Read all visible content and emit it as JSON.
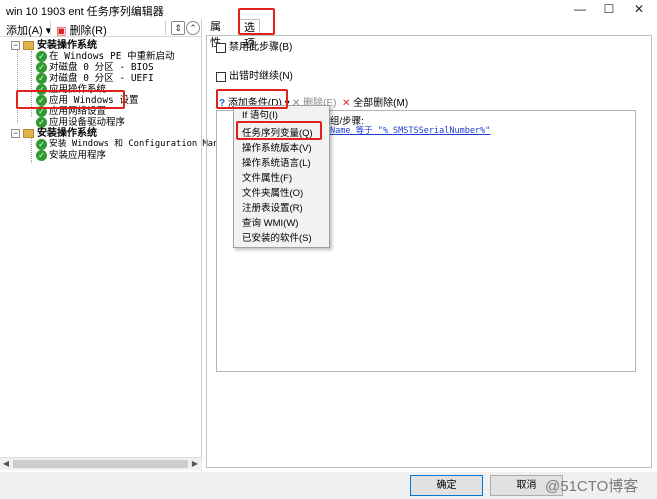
{
  "window": {
    "title": "win 10 1903 ent 任务序列编辑器",
    "minimize": "—",
    "maximize": "☐",
    "close": "✕"
  },
  "left_toolbar": {
    "add_label": "添加(A)",
    "add_caret": "▾",
    "delete_label": "删除(R)",
    "icons": [
      "move-icon",
      "up-arrow-icon",
      "down-arrow-icon"
    ]
  },
  "tree": {
    "group1": "安装操作系统",
    "items1": [
      "在 Windows PE 中重新启动",
      "对磁盘 0 分区 - BIOS",
      "对磁盘 0 分区 - UEFI",
      "应用操作系统",
      "应用 Windows 设置",
      "应用网络设置",
      "应用设备驱动程序"
    ],
    "group2": "安装操作系统",
    "items2": [
      "安装 Windows 和 Configuration Manager",
      "安装应用程序"
    ]
  },
  "tabs": {
    "properties": "属性",
    "options": "选项"
  },
  "options": {
    "disable_step": "禁用此步骤(B)",
    "continue_on_error": "出错时继续(N)"
  },
  "condition_toolbar": {
    "add_condition": "添加条件(D)",
    "caret": "▾",
    "delete": "删除(E)",
    "delete_all": "全部删除(M)"
  },
  "condition_area": {
    "text_fragment": "组/步骤:",
    "condition_link": "Name 等于 \"% SMSTSSerialNumber%\""
  },
  "add_condition_menu": [
    "If 语句(I)",
    "任务序列变量(Q)",
    "操作系统版本(V)",
    "操作系统语言(L)",
    "文件属性(F)",
    "文件夹属性(O)",
    "注册表设置(R)",
    "查询 WMI(W)",
    "已安装的软件(S)"
  ],
  "buttons": {
    "ok": "确定",
    "cancel": "取消"
  },
  "watermark": "@51CTO博客",
  "colors": {
    "highlight_red": "#e0231a",
    "link_blue": "#1a3fd0",
    "check_green": "#2f9a2f"
  }
}
